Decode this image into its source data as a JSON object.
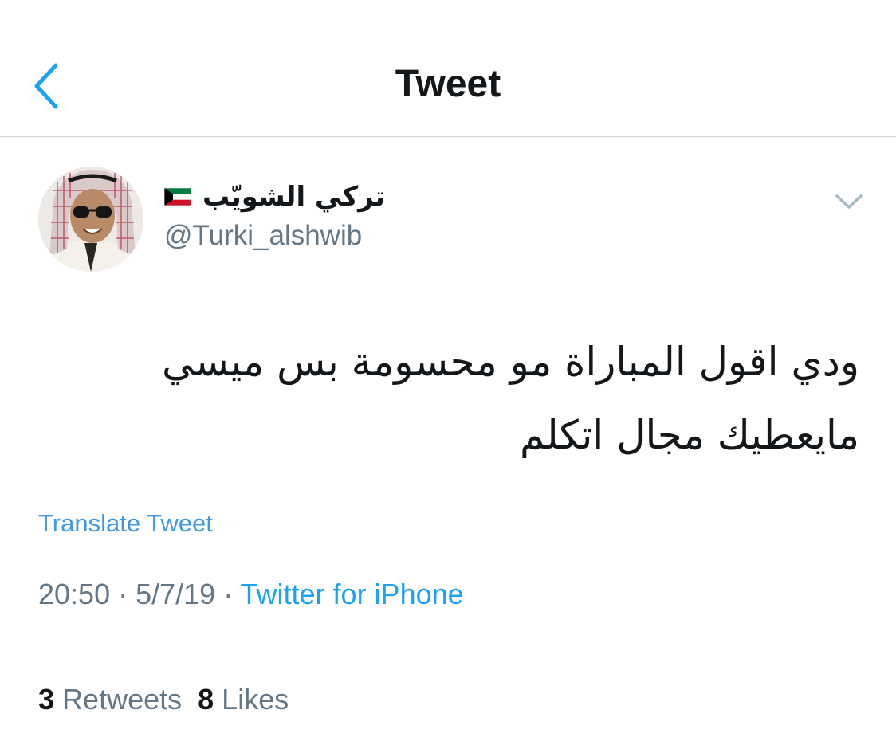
{
  "nav": {
    "title": "Tweet",
    "accent_color": "#1da1f2"
  },
  "tweet": {
    "author": {
      "display_name": "تركي الشويّب",
      "flag_icon": "kuwait-flag-icon",
      "handle": "@Turki_alshwib"
    },
    "text": "ودي اقول المباراة مو محسومة بس ميسي مايعطيك مجال اتكلم",
    "translate_label": "Translate Tweet",
    "time": "20:50",
    "separator": " · ",
    "date": "5/7/19",
    "source": "Twitter for iPhone",
    "retweets_count": "3",
    "retweets_label": "Retweets",
    "likes_count": "8",
    "likes_label": "Likes"
  }
}
